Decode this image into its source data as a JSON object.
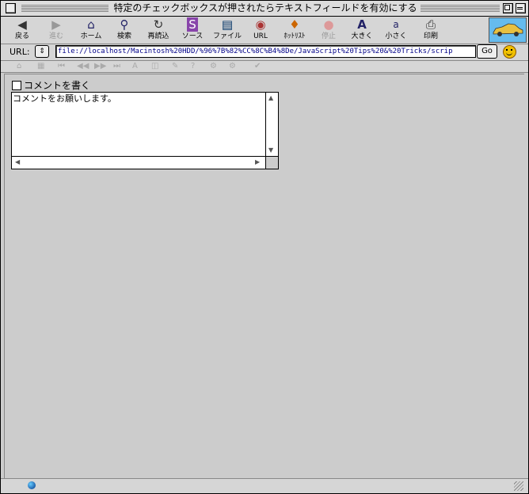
{
  "window": {
    "title": "特定のチェックボックスが押されたらテキストフィールドを有効にする"
  },
  "toolbar": {
    "items": [
      {
        "label": "戻る",
        "icon": "◀",
        "enabled": true
      },
      {
        "label": "進む",
        "icon": "▶",
        "enabled": false
      },
      {
        "label": "ホーム",
        "icon": "⌂",
        "enabled": true
      },
      {
        "label": "検索",
        "icon": "⚲",
        "enabled": true
      },
      {
        "label": "再読込",
        "icon": "↻",
        "enabled": true
      },
      {
        "label": "ソース",
        "icon": "S",
        "enabled": true
      },
      {
        "label": "ファイル",
        "icon": "▤",
        "enabled": true
      },
      {
        "label": "URL",
        "icon": "◉",
        "enabled": true
      },
      {
        "label": "ﾎｯﾄﾘｽﾄ",
        "icon": "♦",
        "enabled": true
      },
      {
        "label": "停止",
        "icon": "●",
        "enabled": false
      },
      {
        "label": "大きく",
        "icon": "A",
        "enabled": true
      },
      {
        "label": "小さく",
        "icon": "a",
        "enabled": true
      },
      {
        "label": "印刷",
        "icon": "⎙",
        "enabled": true
      }
    ]
  },
  "urlbar": {
    "label": "URL:",
    "dropdown_glyph": "⇕",
    "value": "file://localhost/Macintosh%20HDD/%96%7B%82%CC%8C%B4%8De/JavaScript%20Tips%20&%20Tricks/scrip",
    "go_label": "Go"
  },
  "personal_toolbar": {
    "items": [
      "⌂",
      "▦",
      "⏮",
      "◀◀",
      "▶▶",
      "⏭",
      "A",
      "◫",
      "✎",
      "?",
      "⚙",
      "⚙",
      "✔"
    ]
  },
  "content": {
    "checkbox_label": "コメントを書く",
    "checkbox_checked": false,
    "textarea_value": "コメントをお願いします。"
  },
  "status": {
    "text": ""
  }
}
